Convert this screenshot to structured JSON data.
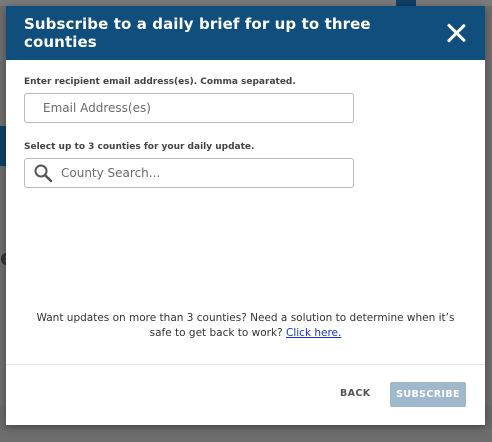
{
  "modal": {
    "title": "Subscribe to a daily brief for up to three counties",
    "email_label": "Enter recipient email address(es). Comma separated.",
    "email_placeholder": "Email Address(es)",
    "county_label": "Select up to 3 counties for your daily update.",
    "county_placeholder": "County Search...",
    "promo_text": "Want updates on more than 3 counties? Need a solution to determine when it’s safe to get back to work?",
    "promo_link": "Click here.",
    "back_label": "BACK",
    "subscribe_label": "SUBSCRIBE"
  },
  "background": {
    "letter": "e"
  },
  "icons": {
    "close": "close-icon",
    "search": "search-icon"
  },
  "colors": {
    "header": "#0f4e7d",
    "subscribe_disabled": "#9fb8cc",
    "link": "#1a33c4"
  }
}
